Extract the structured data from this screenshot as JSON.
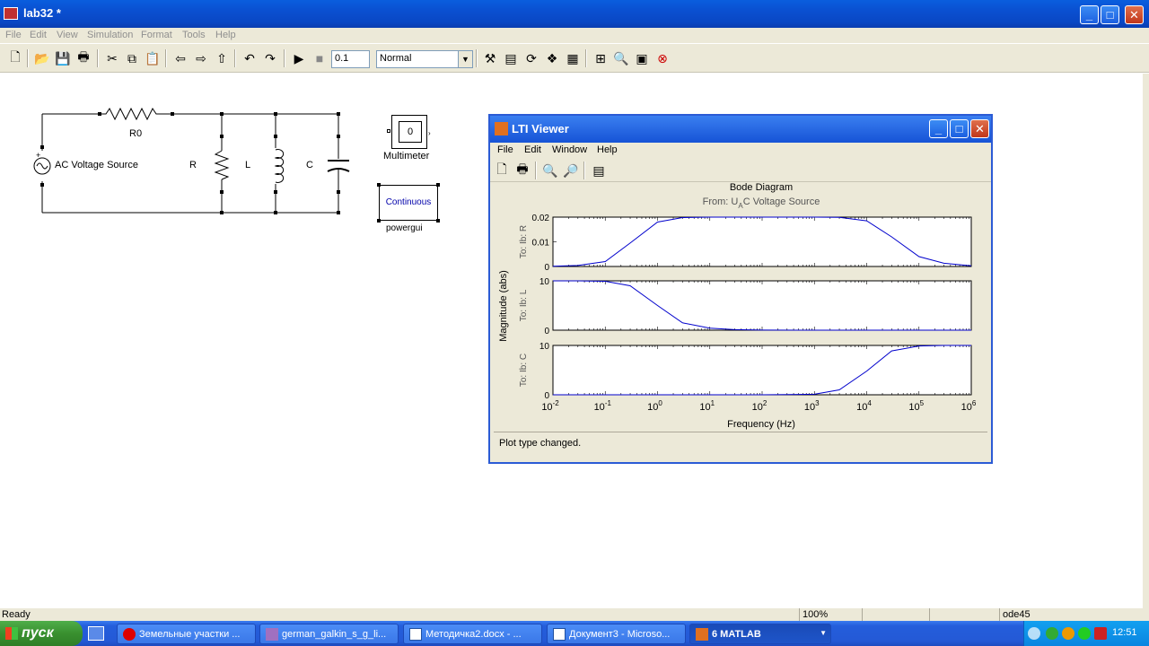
{
  "window": {
    "title": "lab32 *"
  },
  "menu": [
    "File",
    "Edit",
    "View",
    "Simulation",
    "Format",
    "Tools",
    "Help"
  ],
  "toolbar": {
    "stop_time": "0.1",
    "sim_mode": "Normal"
  },
  "model": {
    "r0_label": "R0",
    "source_label": "AC Voltage Source",
    "r_label": "R",
    "l_label": "L",
    "c_label": "C",
    "multimeter_value": "0",
    "multimeter_label": "Multimeter",
    "powergui_text": "Continuous",
    "powergui_label": "powergui"
  },
  "lti": {
    "title": "LTI Viewer",
    "menu": [
      "File",
      "Edit",
      "Window",
      "Help"
    ],
    "plot_title": "Bode Diagram",
    "plot_subtitle_prefix": "From: U",
    "plot_subtitle_sub": "A",
    "plot_subtitle_suffix": "C Voltage Source",
    "ylabel": "Magnitude (abs)",
    "xlabel": "Frequency  (Hz)",
    "status": "Plot type changed."
  },
  "chart_data": {
    "type": "line",
    "title": "Bode Diagram",
    "subtitle": "From: UAC Voltage Source",
    "xlabel": "Frequency  (Hz)",
    "ylabel": "Magnitude (abs)",
    "x_scale": "log",
    "xlim": [
      0.01,
      1000000
    ],
    "x_ticks": [
      "10-2",
      "10-1",
      "100",
      "101",
      "102",
      "103",
      "104",
      "105",
      "106"
    ],
    "subplots": [
      {
        "name": "To: Ib: R",
        "ylim": [
          0,
          0.02
        ],
        "y_ticks": [
          "0",
          "0.01",
          "0.02"
        ],
        "x": [
          0.01,
          0.03,
          0.1,
          0.3,
          1,
          3,
          10,
          100,
          1000,
          3000,
          10000,
          30000,
          100000,
          300000,
          1000000
        ],
        "y": [
          0.0001,
          0.0004,
          0.002,
          0.0095,
          0.018,
          0.0198,
          0.02,
          0.02,
          0.02,
          0.0199,
          0.0185,
          0.012,
          0.004,
          0.0013,
          0.0003
        ]
      },
      {
        "name": "To: Ib: L",
        "ylim": [
          0,
          10
        ],
        "y_ticks": [
          "0",
          "10"
        ],
        "x": [
          0.01,
          0.03,
          0.1,
          0.3,
          1,
          3,
          10,
          30,
          100,
          1000,
          10000,
          100000,
          1000000
        ],
        "y": [
          10,
          10,
          9.9,
          9.0,
          5.0,
          1.5,
          0.4,
          0.1,
          0.02,
          0,
          0,
          0,
          0
        ]
      },
      {
        "name": "To: Ib: C",
        "ylim": [
          0,
          10
        ],
        "y_ticks": [
          "0",
          "10"
        ],
        "x": [
          0.01,
          1,
          100,
          1000,
          3000,
          10000,
          30000,
          100000,
          300000,
          1000000
        ],
        "y": [
          0,
          0,
          0,
          0.1,
          1.0,
          4.8,
          8.9,
          9.9,
          10,
          10
        ]
      }
    ]
  },
  "status": {
    "ready": "Ready",
    "zoom": "100%",
    "solver": "ode45"
  },
  "taskbar": {
    "start": "пуск",
    "items": [
      "Земельные участки ...",
      "german_galkin_s_g_li...",
      "Методичка2.docx - ...",
      "Документ3 - Microso...",
      "6 MATLAB"
    ],
    "clock": "12:51"
  },
  "colors": {
    "accent": "#0a4fd0",
    "plot_line": "#0000cc"
  }
}
